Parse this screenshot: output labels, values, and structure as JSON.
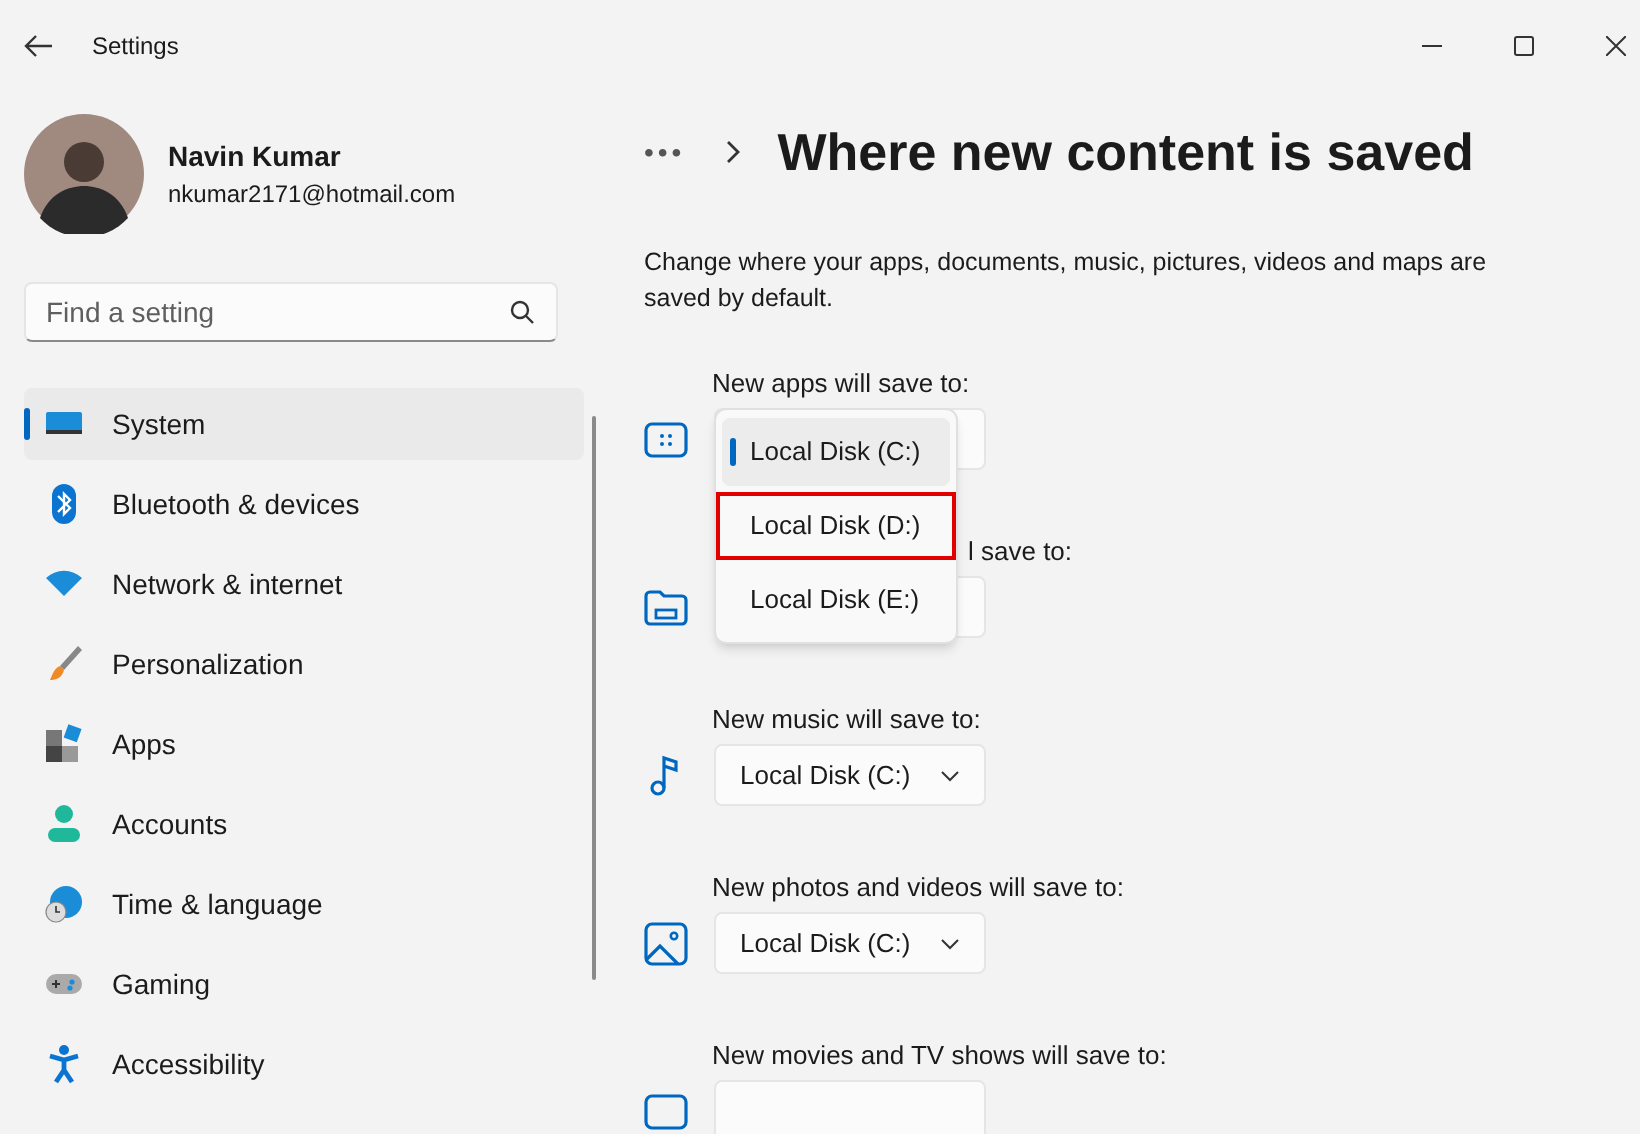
{
  "window": {
    "title": "Settings"
  },
  "user": {
    "name": "Navin Kumar",
    "email": "nkumar2171@hotmail.com"
  },
  "search": {
    "placeholder": "Find a setting"
  },
  "nav": [
    {
      "kind": "system",
      "label": "System",
      "selected": true
    },
    {
      "kind": "bluetooth",
      "label": "Bluetooth & devices",
      "selected": false
    },
    {
      "kind": "network",
      "label": "Network & internet",
      "selected": false
    },
    {
      "kind": "personalization",
      "label": "Personalization",
      "selected": false
    },
    {
      "kind": "apps",
      "label": "Apps",
      "selected": false
    },
    {
      "kind": "accounts",
      "label": "Accounts",
      "selected": false
    },
    {
      "kind": "time",
      "label": "Time & language",
      "selected": false
    },
    {
      "kind": "gaming",
      "label": "Gaming",
      "selected": false
    },
    {
      "kind": "accessibility",
      "label": "Accessibility",
      "selected": false
    }
  ],
  "breadcrumb": {
    "overflow": "•••",
    "title": "Where new content is saved"
  },
  "description": "Change where your apps, documents, music, pictures, videos and maps are saved by default.",
  "settings": [
    {
      "kind": "apps",
      "label": "New apps will save to:"
    },
    {
      "kind": "documents",
      "label": "l save to:"
    },
    {
      "kind": "music",
      "label": "New music will save to:",
      "value": "Local Disk (C:)"
    },
    {
      "kind": "photos",
      "label": "New photos and videos will save to:",
      "value": "Local Disk (C:)"
    },
    {
      "kind": "movies",
      "label": "New movies and TV shows will save to:"
    }
  ],
  "dropdown_menu": {
    "options": [
      {
        "label": "Local Disk (C:)",
        "selected": true,
        "highlighted": false
      },
      {
        "label": "Local Disk (D:)",
        "selected": false,
        "highlighted": true
      },
      {
        "label": "Local Disk (E:)",
        "selected": false,
        "highlighted": false
      }
    ]
  }
}
